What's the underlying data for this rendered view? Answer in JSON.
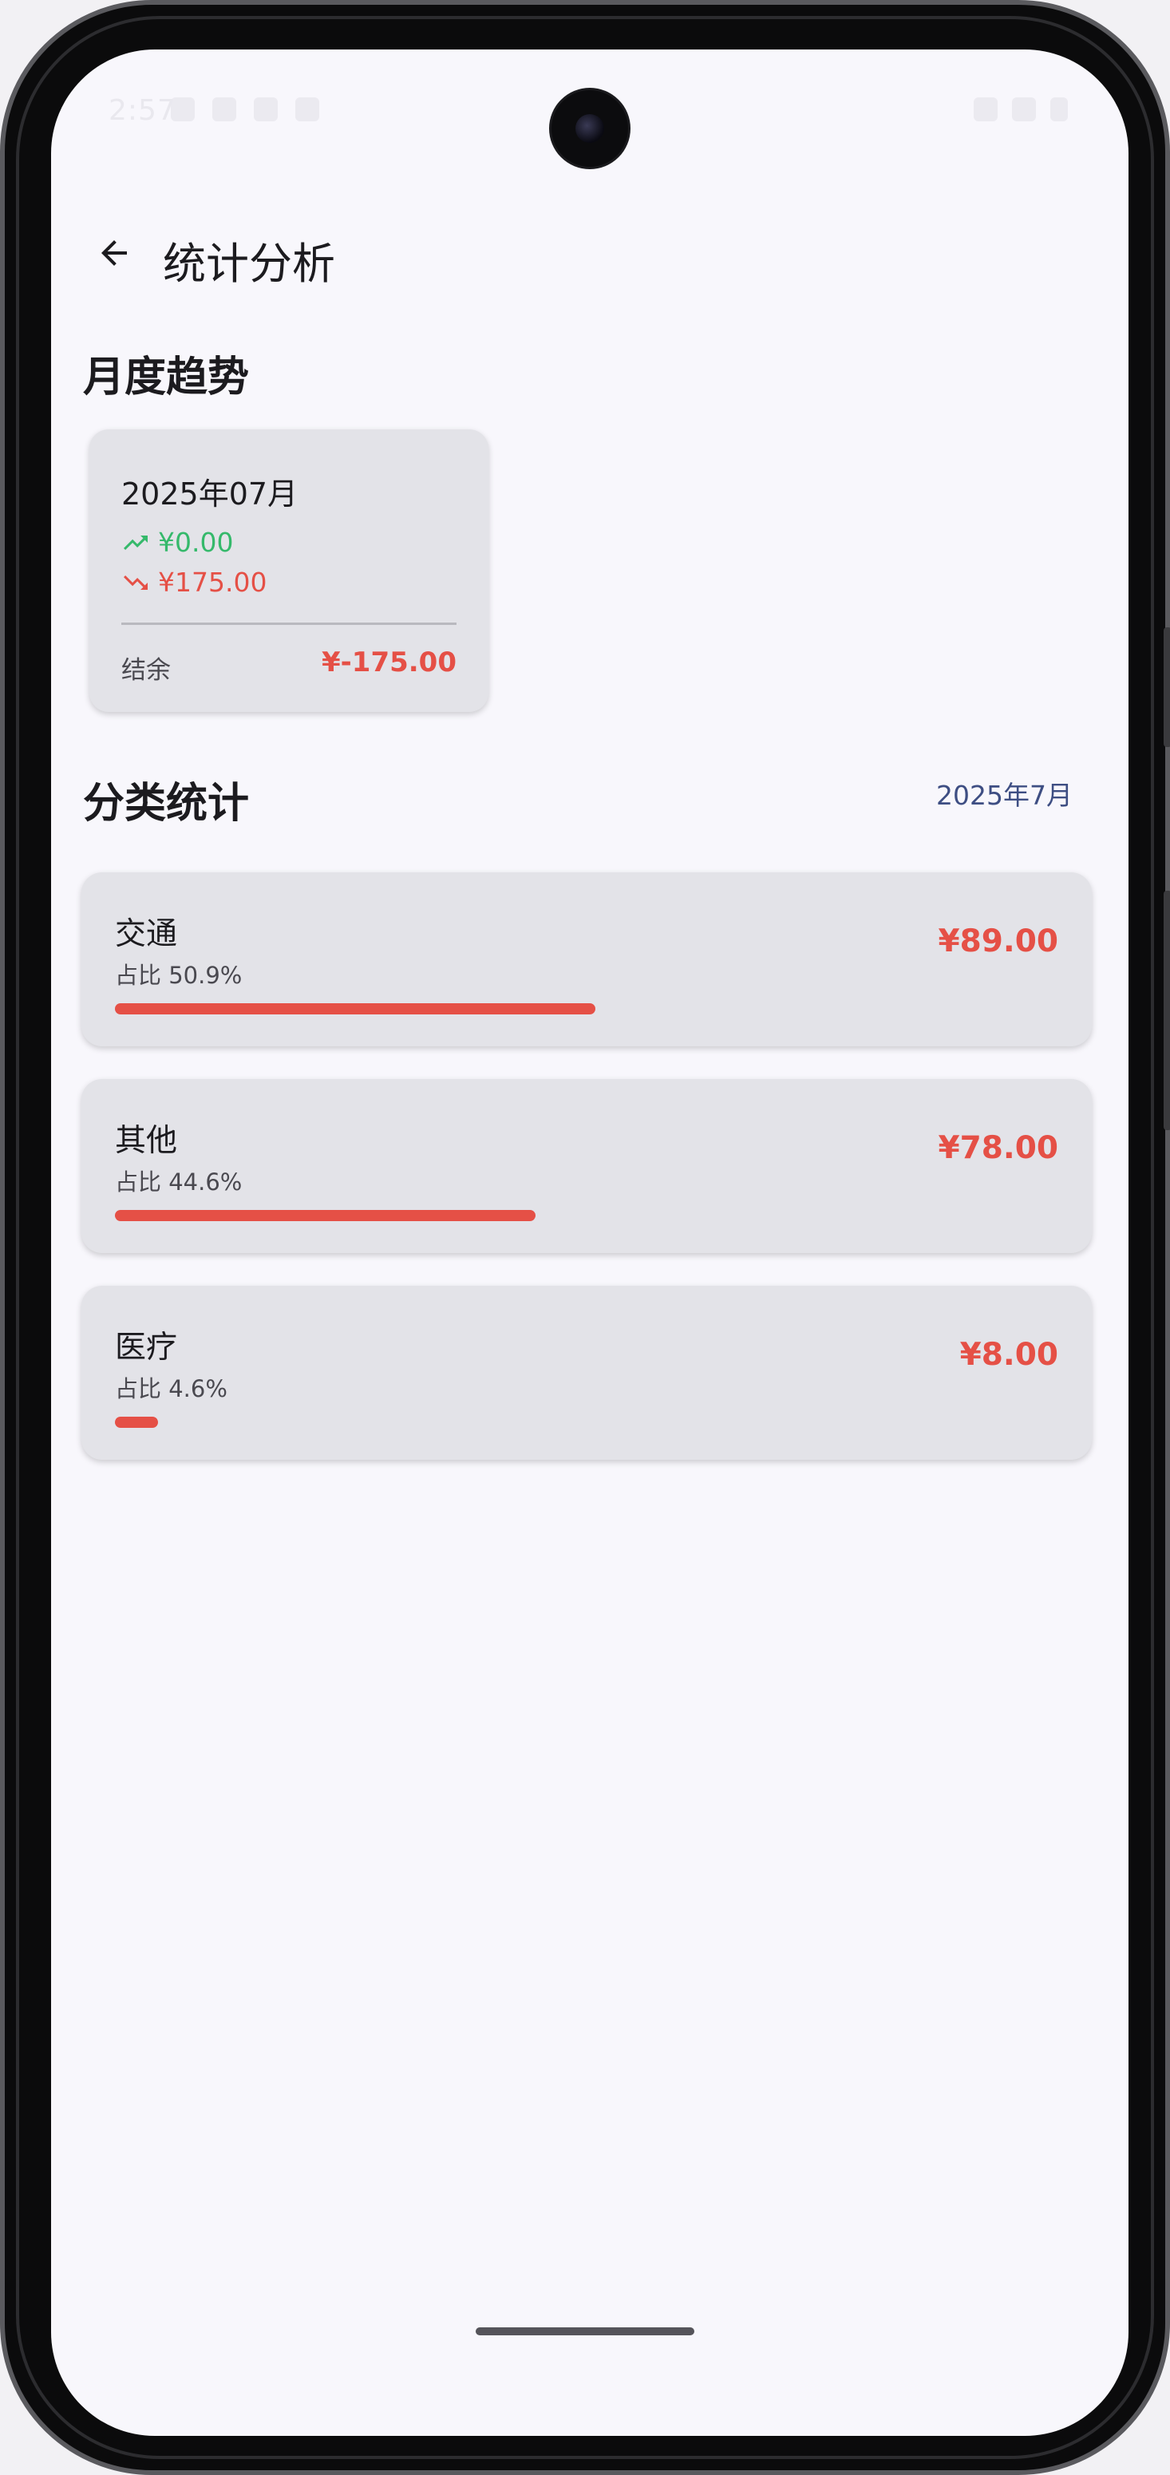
{
  "status_bar": {
    "time": "2:57"
  },
  "app_bar": {
    "back_icon": "arrow-back-icon",
    "title": "统计分析"
  },
  "monthly_trend": {
    "section_title": "月度趋势",
    "cards": [
      {
        "month": "2025年07月",
        "income": "¥0.00",
        "income_icon": "trending-up-icon",
        "expense": "¥175.00",
        "expense_icon": "trending-down-icon",
        "balance_label": "结余",
        "balance": "¥-175.00"
      }
    ]
  },
  "category_stats": {
    "section_title": "分类统计",
    "period": "2025年7月",
    "items": [
      {
        "name": "交通",
        "share_label": "占比 50.9%",
        "share": 0.509,
        "amount": "¥89.00"
      },
      {
        "name": "其他",
        "share_label": "占比 44.6%",
        "share": 0.446,
        "amount": "¥78.00"
      },
      {
        "name": "医疗",
        "share_label": "占比 4.6%",
        "share": 0.046,
        "amount": "¥8.00"
      }
    ]
  },
  "colors": {
    "income": "#35b96b",
    "expense": "#e55046",
    "accent": "#3e4e83",
    "card": "#e3e3e8",
    "background": "#f8f7fc"
  }
}
